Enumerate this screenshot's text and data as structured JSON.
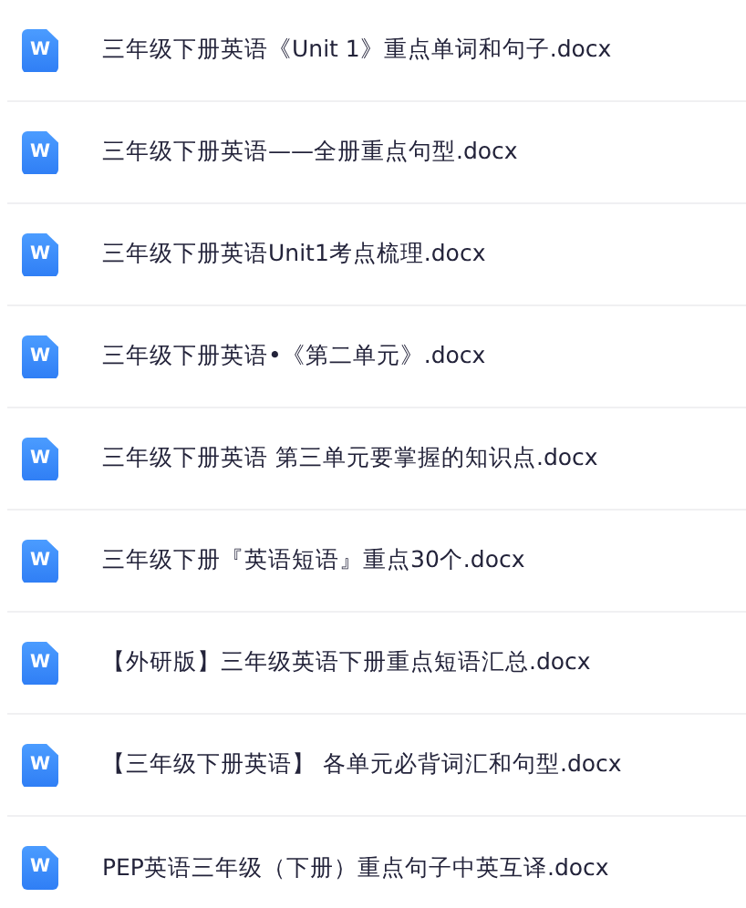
{
  "files": [
    {
      "icon": "W",
      "name": "三年级下册英语《Unit 1》重点单词和句子.docx"
    },
    {
      "icon": "W",
      "name": "三年级下册英语——全册重点句型.docx"
    },
    {
      "icon": "W",
      "name": "三年级下册英语Unit1考点梳理.docx"
    },
    {
      "icon": "W",
      "name": "三年级下册英语•《第二单元》.docx"
    },
    {
      "icon": "W",
      "name": "三年级下册英语 第三单元要掌握的知识点.docx"
    },
    {
      "icon": "W",
      "name": "三年级下册『英语短语』重点30个.docx"
    },
    {
      "icon": "W",
      "name": "【外研版】三年级英语下册重点短语汇总.docx"
    },
    {
      "icon": "W",
      "name": "【三年级下册英语】 各单元必背词汇和句型.docx"
    },
    {
      "icon": "W",
      "name": "PEP英语三年级（下册）重点句子中英互译.docx"
    }
  ]
}
